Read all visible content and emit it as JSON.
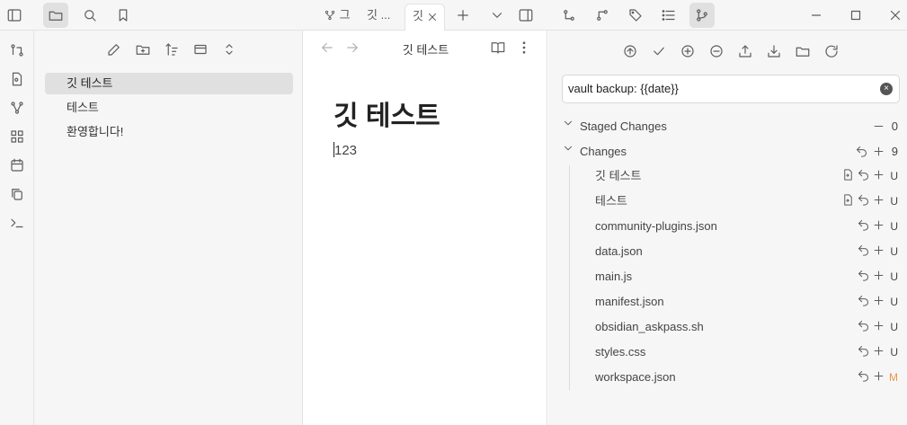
{
  "tabs": [
    {
      "label": "그",
      "icon": "git-branch-icon"
    },
    {
      "label": "깃 ..."
    },
    {
      "label": "깃",
      "active": true
    }
  ],
  "editor": {
    "view_title": "깃 테스트",
    "note_title": "깃 테스트",
    "note_body": "123"
  },
  "explorer": {
    "files": [
      "깃 테스트",
      "테스트",
      "환영합니다!"
    ],
    "active_file": "깃 테스트"
  },
  "git": {
    "commit_message": "vault backup: {{date}}",
    "staged": {
      "label": "Staged Changes",
      "count": "0"
    },
    "changes": {
      "label": "Changes",
      "count": "9"
    },
    "files": [
      {
        "name": "깃 테스트",
        "status": "U",
        "open": true
      },
      {
        "name": "테스트",
        "status": "U",
        "open": true
      },
      {
        "name": "community-plugins.json",
        "status": "U"
      },
      {
        "name": "data.json",
        "status": "U"
      },
      {
        "name": "main.js",
        "status": "U"
      },
      {
        "name": "manifest.json",
        "status": "U"
      },
      {
        "name": "obsidian_askpass.sh",
        "status": "U"
      },
      {
        "name": "styles.css",
        "status": "U"
      },
      {
        "name": "workspace.json",
        "status": "M"
      }
    ]
  },
  "colors": {
    "accent": "#e8964a",
    "bg": "#f6f6f6"
  }
}
